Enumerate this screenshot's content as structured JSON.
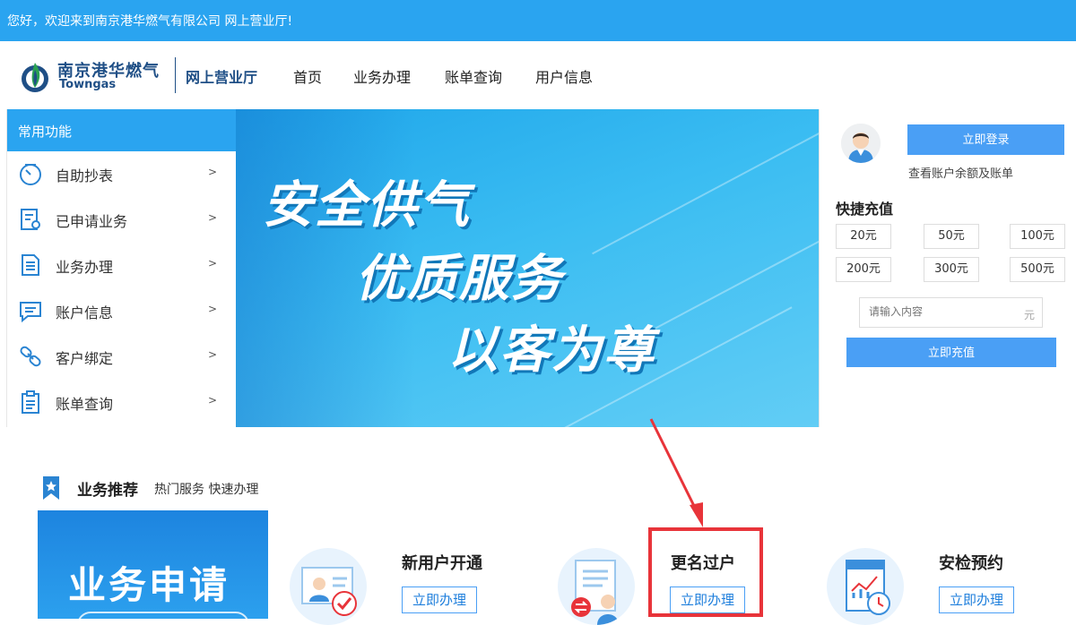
{
  "topbar": {
    "welcome": "您好，欢迎来到南京港华燃气有限公司 网上营业厅!"
  },
  "header": {
    "logo_cn": "南京港华燃气",
    "logo_en": "Towngas",
    "logo_sub": "网上营业厅",
    "nav": [
      "首页",
      "业务办理",
      "账单查询",
      "用户信息"
    ]
  },
  "sidebar": {
    "title": "常用功能",
    "items": [
      {
        "label": "自助抄表",
        "icon": "dial-icon"
      },
      {
        "label": "已申请业务",
        "icon": "form-icon"
      },
      {
        "label": "业务办理",
        "icon": "document-icon"
      },
      {
        "label": "账户信息",
        "icon": "chat-icon"
      },
      {
        "label": "客户绑定",
        "icon": "link-icon"
      },
      {
        "label": "账单查询",
        "icon": "clipboard-icon"
      }
    ],
    "arrow": ">"
  },
  "banner": {
    "lines": [
      "安全供气",
      "优质服务",
      "以客为尊"
    ]
  },
  "account": {
    "login": "立即登录",
    "link": "查看账户余额及账单"
  },
  "recharge": {
    "title": "快捷充值",
    "amounts": [
      "20元",
      "50元",
      "100元",
      "200元",
      "300元",
      "500元"
    ],
    "placeholder": "请输入内容",
    "unit": "元",
    "button": "立即充值"
  },
  "recommend": {
    "title": "业务推荐",
    "subtitle": "热门服务 快速办理",
    "card": "业务申请",
    "services": [
      {
        "title": "新用户开通",
        "button": "立即办理",
        "icon": "new-user-icon"
      },
      {
        "title": "更名过户",
        "button": "立即办理",
        "icon": "transfer-icon"
      },
      {
        "title": "安检预约",
        "button": "立即办理",
        "icon": "report-icon"
      }
    ]
  },
  "colors": {
    "brand_blue": "#2aa4f0",
    "button_blue": "#4a9ff5",
    "highlight_red": "#e8343a",
    "logo_navy": "#1f4f86"
  }
}
